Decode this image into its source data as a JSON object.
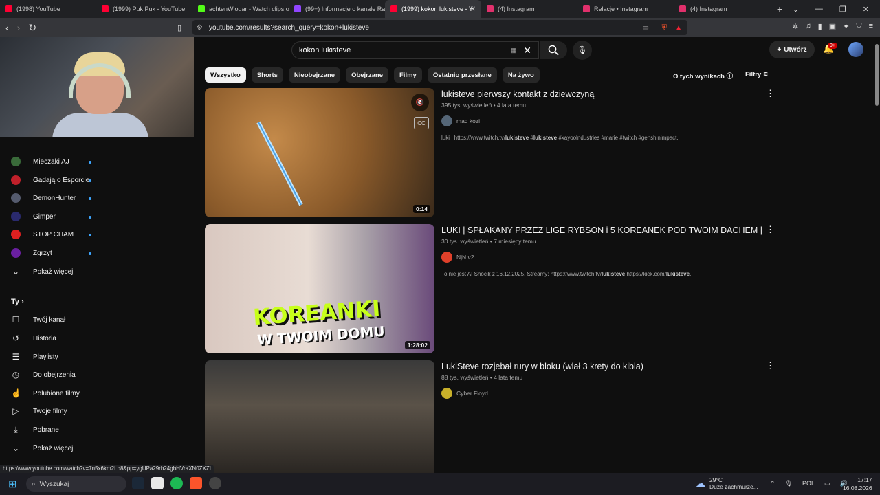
{
  "browser": {
    "tabs": [
      {
        "label": "(1998) YouTube",
        "color": "#ff0033"
      },
      {
        "label": "(1999) Puk Puk - YouTube",
        "color": "#ff0033"
      },
      {
        "label": "achtenWlodar - Watch clips o",
        "color": "#53fc18"
      },
      {
        "label": "(99+) Informacje o kanale Ra",
        "color": "#9146ff"
      },
      {
        "label": "(1999) kokon lukisteve - Y",
        "color": "#ff0033",
        "active": true
      },
      {
        "label": "(4) Instagram",
        "color": "#e1306c"
      },
      {
        "label": "Relacje • Instagram",
        "color": "#e1306c"
      },
      {
        "label": "(4) Instagram",
        "color": "#e1306c"
      }
    ],
    "url": "youtube.com/results?search_query=kokon+lukisteve",
    "status_url": "https://www.youtube.com/watch?v=7n5x6km2Lb8&pp=ygUPa29rb24gbHVraXN0ZXZI"
  },
  "youtube": {
    "search_query": "kokon lukisteve",
    "create_label": "Utwórz",
    "notif_badge": "9+",
    "chips": [
      "Wszystko",
      "Shorts",
      "Nieobejrzane",
      "Obejrzane",
      "Filmy",
      "Ostatnio przesłane",
      "Na żywo"
    ],
    "about_results": "O tych wynikach",
    "filters": "Filtry"
  },
  "sidebar": {
    "subs": [
      {
        "label": "Mieczaki AJ",
        "color": "#3a6b3a"
      },
      {
        "label": "Gadają o Esporcie",
        "color": "#c0202a"
      },
      {
        "label": "DemonHunter",
        "color": "#555b6e"
      },
      {
        "label": "Gimper",
        "color": "#2a2a6e"
      },
      {
        "label": "STOP CHAM",
        "color": "#e02020"
      },
      {
        "label": "Zgrzyt",
        "color": "#6a1fa0"
      }
    ],
    "show_more": "Pokaż więcej",
    "you_label": "Ty",
    "you_items": [
      {
        "label": "Twój kanał",
        "icon": "channel-icon"
      },
      {
        "label": "Historia",
        "icon": "history-icon"
      },
      {
        "label": "Playlisty",
        "icon": "playlist-icon"
      },
      {
        "label": "Do obejrzenia",
        "icon": "watch-later-icon"
      },
      {
        "label": "Polubione filmy",
        "icon": "like-icon"
      },
      {
        "label": "Twoje filmy",
        "icon": "video-icon"
      },
      {
        "label": "Pobrane",
        "icon": "download-icon"
      }
    ],
    "show_more2": "Pokaż więcej"
  },
  "results": [
    {
      "title": "lukisteve pierwszy kontakt z dziewczyną",
      "meta": "395 tys. wyświetleń • 4 lata temu",
      "channel": "mad kozi",
      "channel_color": "#556677",
      "desc_parts": [
        "luki : https://www.twitch.tv/",
        "lukisteve",
        " #",
        "lukisteve",
        " #xayoolndustries #marie #twitch #genshinimpact."
      ],
      "duration": "0:14"
    },
    {
      "title": "LUKI | SPŁAKANY PRZEZ LIGE RYBSON i 5 KOREANEK POD TWOIM DACHEM |",
      "meta": "30 tys. wyświetleń • 7 miesięcy temu",
      "channel": "NjN v2",
      "channel_color": "#e0402a",
      "desc_parts": [
        "To nie jest AI Shocik z 16.12.2025. Streamy: https://www.twitch.tv/",
        "lukisteve",
        " https://kick.com/",
        "lukisteve",
        "."
      ],
      "duration": "1:28:02",
      "overlay_top": "KOREANKI",
      "overlay_bottom": "W TWOIM DOMU"
    },
    {
      "title": "LukiSteve rozjebał rury w bloku (wlał 3 krety do kibla)",
      "meta": "88 tys. wyświetleń • 4 lata temu",
      "channel": "Cyber Floyd",
      "channel_color": "#c8b02a"
    }
  ],
  "taskbar": {
    "search": "Wyszukaj",
    "temp": "29°C",
    "weather": "Duże zachmurze...",
    "lang": "POL",
    "time": "17:17",
    "date": "16.08.2026"
  }
}
